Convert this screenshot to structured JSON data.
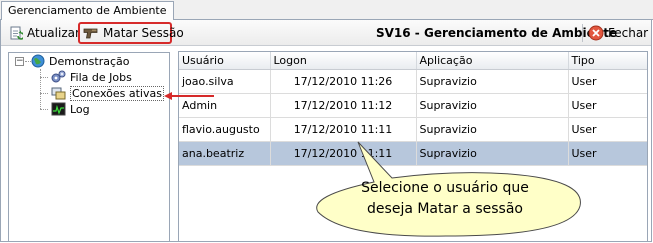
{
  "tab": {
    "label": "Gerenciamento de Ambiente"
  },
  "toolbar": {
    "refresh_label": "Atualizar",
    "kill_session_label": "Matar Sessão",
    "title": "SV16 - Gerenciamento de Ambiente",
    "close_label": "Fechar",
    "highlight_color": "#d62a2a"
  },
  "tree": {
    "root": {
      "label": "Demonstração",
      "icon": "globe-icon",
      "expander": "−"
    },
    "children": [
      {
        "label": "Fila de Jobs",
        "icon": "gears-icon"
      },
      {
        "label": "Conexões ativas",
        "icon": "connections-icon"
      },
      {
        "label": "Log",
        "icon": "log-monitor-icon"
      }
    ]
  },
  "grid": {
    "columns": [
      "Usuário",
      "Logon",
      "Aplicação",
      "Tipo"
    ],
    "rows": [
      [
        "joao.silva",
        "17/12/2010 11:26",
        "Supravizio",
        "User"
      ],
      [
        "Admin",
        "17/12/2010 11:12",
        "Supravizio",
        "User"
      ],
      [
        "flavio.augusto",
        "17/12/2010 11:11",
        "Supravizio",
        "User"
      ],
      [
        "ana.beatriz",
        "17/12/2010 11:11",
        "Supravizio",
        "User"
      ]
    ],
    "selected_row_color": "#b7c7dc"
  },
  "callout": {
    "line1": "Selecione o usuário que",
    "line2": "deseja Matar a sessão",
    "fill_color": "#ffffc8"
  }
}
